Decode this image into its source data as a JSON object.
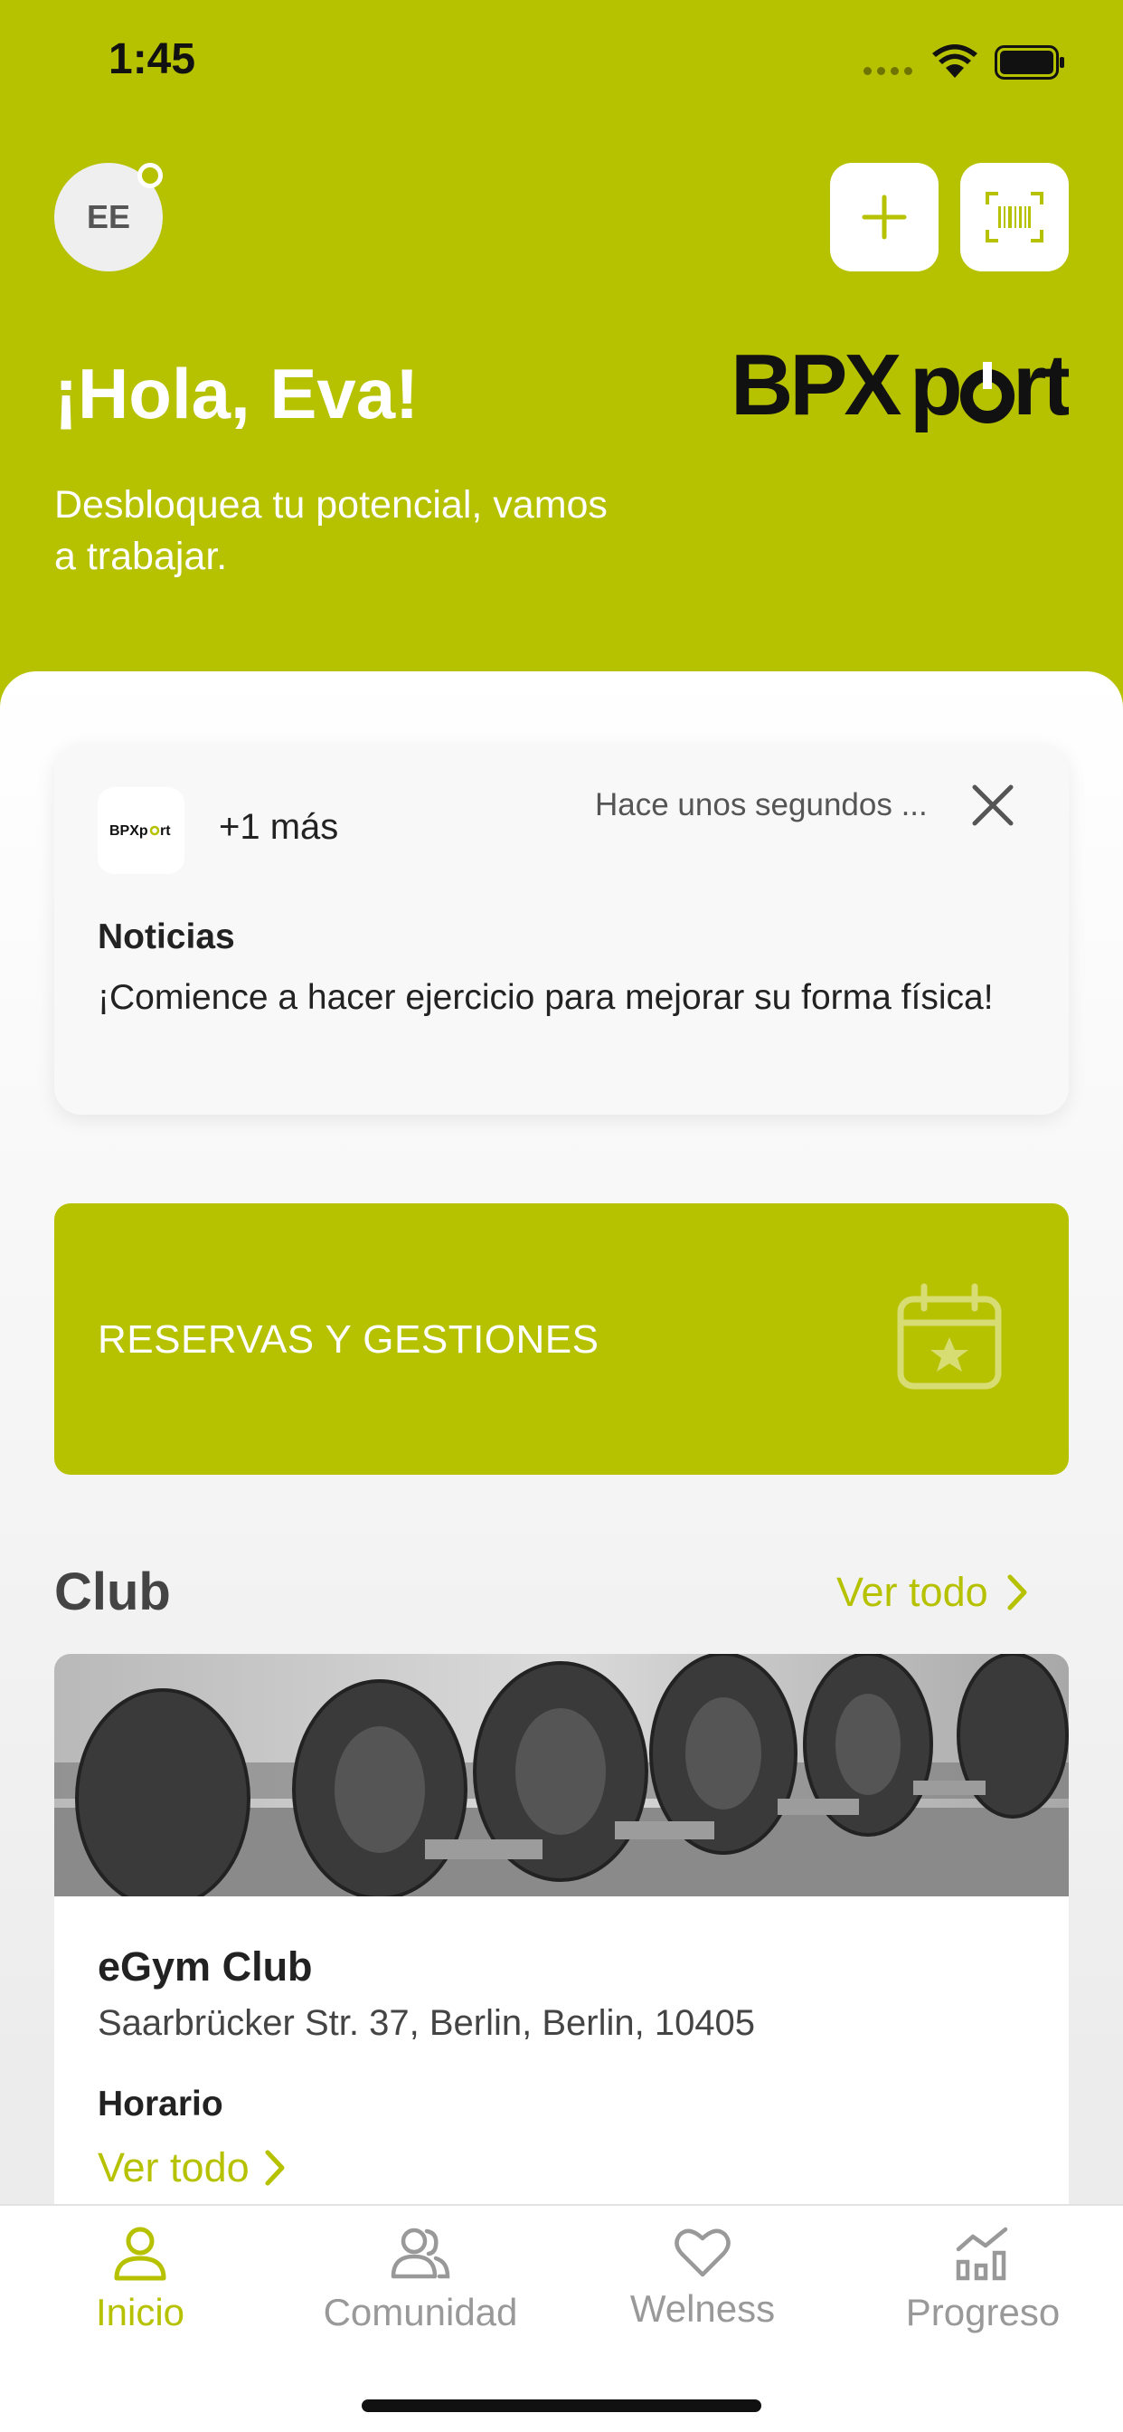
{
  "status_bar": {
    "time": "1:45"
  },
  "header": {
    "avatar_initials": "EE",
    "greeting": "¡Hola, Eva!",
    "subtitle": "Desbloquea tu potencial, vamos a trabajar.",
    "brand_logo": "BPXport",
    "add_icon": "plus-icon",
    "scan_icon": "barcode-scan-icon",
    "accent_color": "#b6c100"
  },
  "notification": {
    "logo_text": "BPXport",
    "more": "+1 más",
    "time": "Hace unos segundos ...",
    "title": "Noticias",
    "body": "¡Comience a hacer ejercicio para mejorar su forma física!"
  },
  "reservations": {
    "label": "RESERVAS Y GESTIONES",
    "icon": "calendar-star-icon"
  },
  "club_section": {
    "title": "Club",
    "see_all": "Ver todo",
    "club": {
      "name": "eGym Club",
      "address": "Saarbrücker Str. 37, Berlin, Berlin, 10405",
      "hours_label": "Horario",
      "hours_link": "Ver todo"
    }
  },
  "bottom_nav": {
    "items": [
      {
        "label": "Inicio",
        "icon": "person-icon",
        "active": true
      },
      {
        "label": "Comunidad",
        "icon": "people-icon",
        "active": false
      },
      {
        "label": "Welness",
        "icon": "heart-icon",
        "active": false
      },
      {
        "label": "Progreso",
        "icon": "chart-icon",
        "active": false
      }
    ]
  }
}
